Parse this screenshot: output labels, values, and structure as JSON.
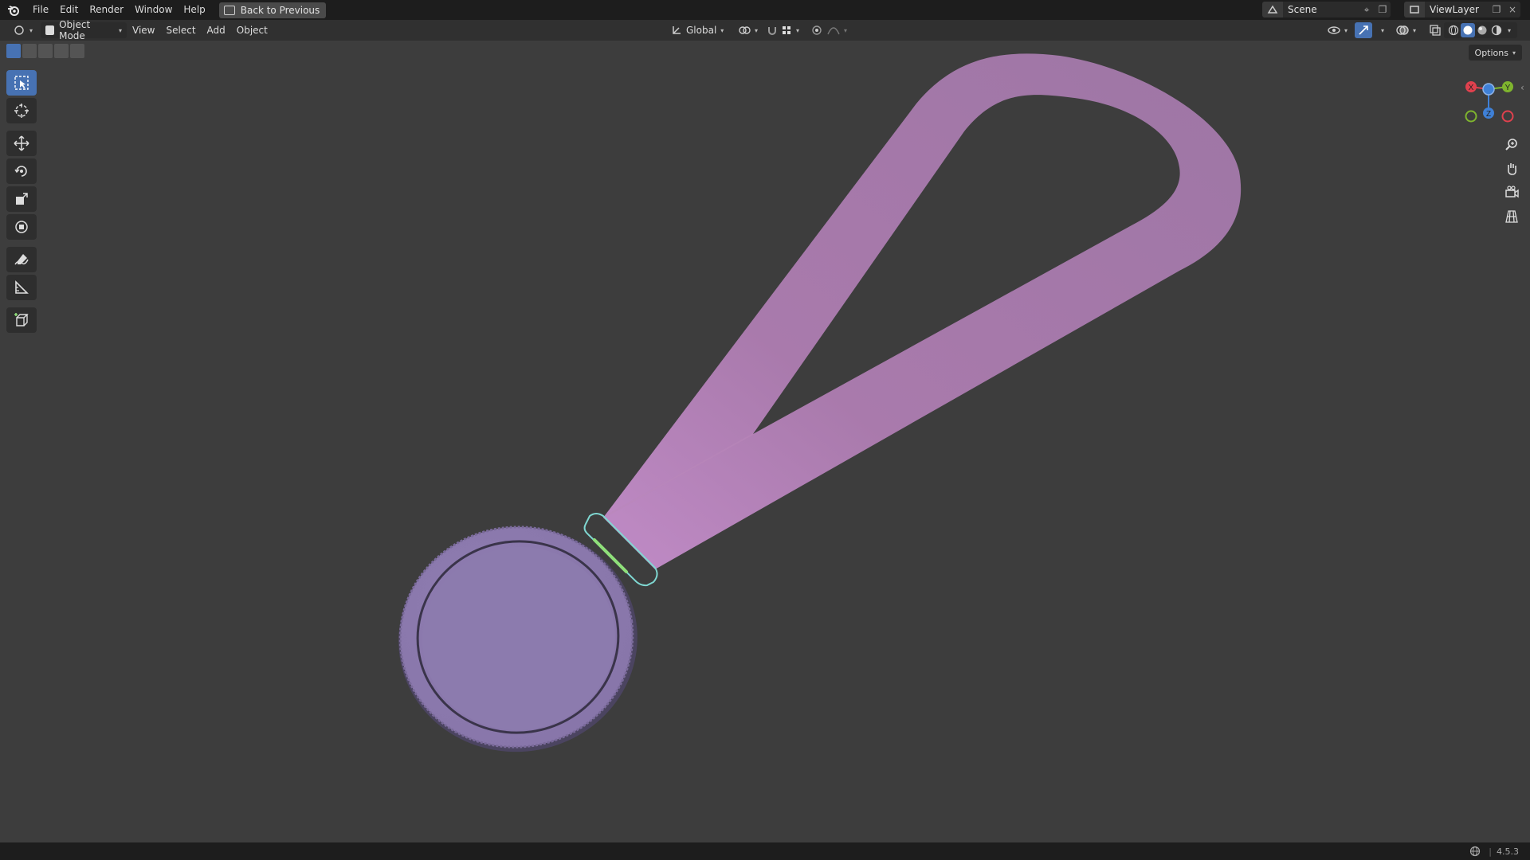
{
  "topbar": {
    "menu": [
      "File",
      "Edit",
      "Render",
      "Window",
      "Help"
    ],
    "back_label": "Back to Previous",
    "scene_label": "Scene",
    "viewlayer_label": "ViewLayer"
  },
  "header": {
    "mode_label": "Object Mode",
    "menus": [
      "View",
      "Select",
      "Add",
      "Object"
    ],
    "orientation_label": "Global"
  },
  "options_label": "Options",
  "gizmo_axes": {
    "x": "X",
    "y": "Y",
    "z": "Z"
  },
  "status": {
    "version": "4.5.3"
  },
  "colors": {
    "accent": "#4772b3",
    "ribbon": "#a277a6",
    "medal": "#8a79a8",
    "clip_outline": "#7fd7d1",
    "axis_x": "#e0414e",
    "axis_y": "#7fb52e",
    "axis_z": "#3f80d6"
  },
  "toolbar_tools": [
    "select-box-icon",
    "cursor-icon",
    "move-icon",
    "rotate-icon",
    "scale-icon",
    "transform-icon",
    "annotate-icon",
    "measure-icon",
    "add-cube-icon"
  ]
}
